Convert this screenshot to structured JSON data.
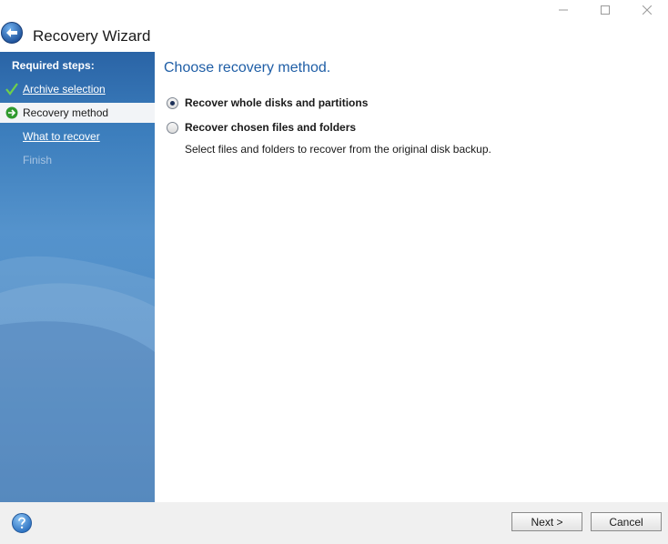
{
  "window": {
    "title": "Recovery Wizard"
  },
  "sidebar": {
    "heading": "Required steps:",
    "steps": [
      {
        "label": "Archive selection",
        "state": "completed"
      },
      {
        "label": "Recovery method",
        "state": "current"
      },
      {
        "label": "What to recover",
        "state": "pending"
      },
      {
        "label": "Finish",
        "state": "disabled"
      }
    ]
  },
  "main": {
    "heading": "Choose recovery method.",
    "options": [
      {
        "label": "Recover whole disks and partitions",
        "checked": true
      },
      {
        "label": "Recover chosen files and folders",
        "checked": false
      }
    ],
    "description": "Select files and folders to recover from the original disk backup."
  },
  "footer": {
    "next_label": "Next >",
    "cancel_label": "Cancel"
  },
  "colors": {
    "accent": "#1f5ea6",
    "sidebar_top": "#2a64a6",
    "sidebar_bottom": "#3f7fbd",
    "completed_check": "#6fd04a"
  },
  "icons": {
    "back": "back-arrow-icon",
    "check": "check-icon",
    "current": "arrow-right-icon",
    "help": "help-icon"
  }
}
